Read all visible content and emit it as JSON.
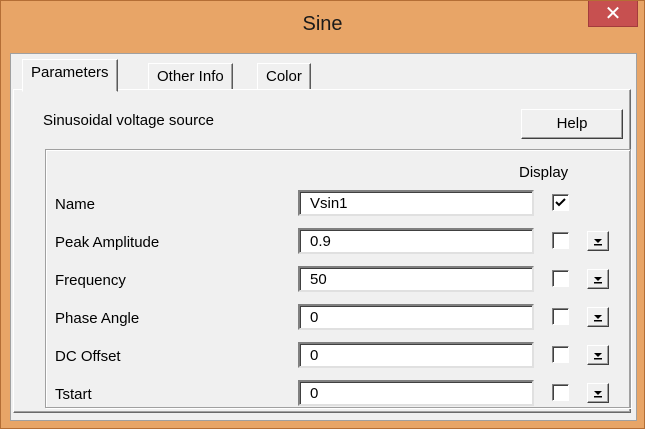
{
  "window": {
    "title": "Sine",
    "close_glyph": "✕"
  },
  "tabs": [
    {
      "label": "Parameters",
      "active": true
    },
    {
      "label": "Other Info",
      "active": false
    },
    {
      "label": "Color",
      "active": false
    }
  ],
  "description": "Sinusoidal voltage source",
  "help_label": "Help",
  "display_header": "Display",
  "rows": [
    {
      "label": "Name",
      "value": "Vsin1",
      "display_checked": true,
      "has_dropdown": false
    },
    {
      "label": "Peak Amplitude",
      "value": "0.9",
      "display_checked": false,
      "has_dropdown": true
    },
    {
      "label": "Frequency",
      "value": "50",
      "display_checked": false,
      "has_dropdown": true
    },
    {
      "label": "Phase Angle",
      "value": "0",
      "display_checked": false,
      "has_dropdown": true
    },
    {
      "label": "DC Offset",
      "value": "0",
      "display_checked": false,
      "has_dropdown": true
    },
    {
      "label": "Tstart",
      "value": "0",
      "display_checked": false,
      "has_dropdown": true
    }
  ],
  "icons": {
    "close": "close-icon",
    "checkmark": "checkmark-icon",
    "dropdown": "dropdown-arrow-icon"
  },
  "colors": {
    "title_bar": "#e8a567",
    "close_button": "#c75050",
    "dialog_bg": "#f0f0f0"
  }
}
